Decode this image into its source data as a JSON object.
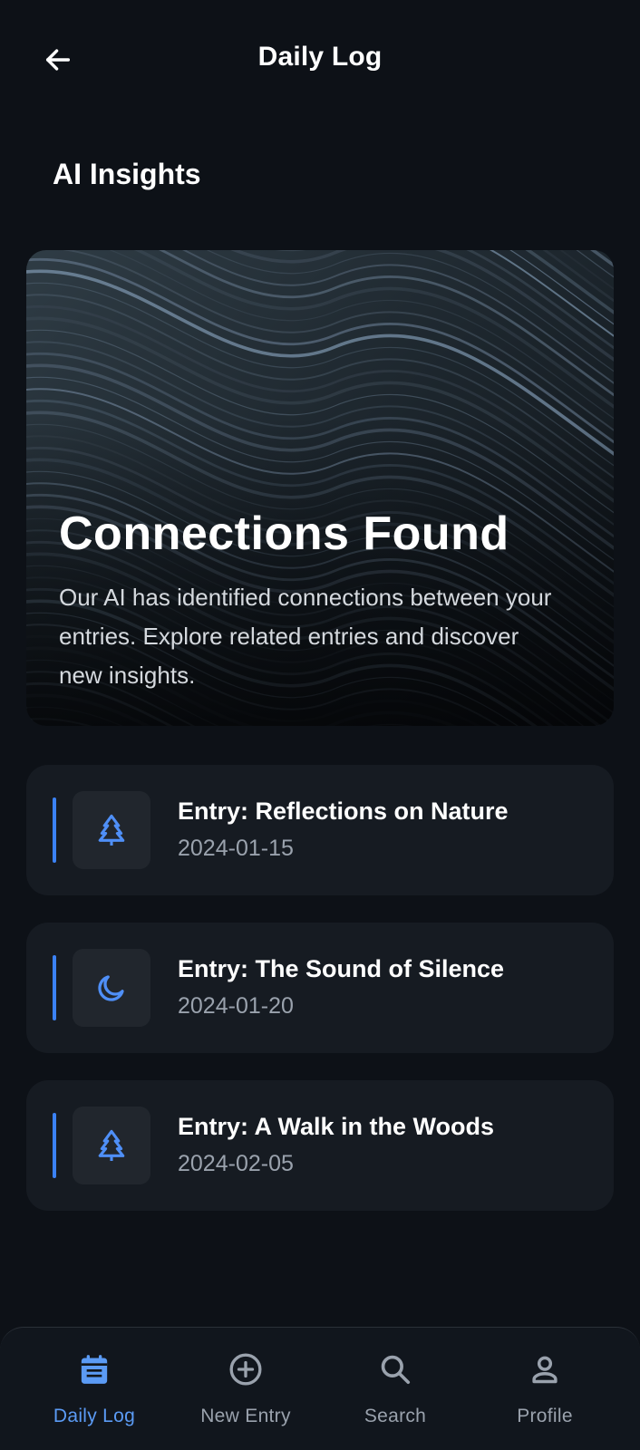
{
  "header": {
    "title": "Daily Log",
    "back_icon": "arrow-left-icon"
  },
  "section": {
    "title": "AI Insights"
  },
  "hero": {
    "title": "Connections Found",
    "description": "Our AI has identified connections between your entries. Explore related entries and discover new insights."
  },
  "entries": [
    {
      "title": "Entry: Reflections on Nature",
      "date": "2024-01-15",
      "icon": "tree-icon"
    },
    {
      "title": "Entry: The Sound of Silence",
      "date": "2024-01-20",
      "icon": "moon-icon"
    },
    {
      "title": "Entry: A Walk in the Woods",
      "date": "2024-02-05",
      "icon": "tree-icon"
    }
  ],
  "nav": [
    {
      "label": "Daily Log",
      "icon": "calendar-icon",
      "active": true
    },
    {
      "label": "New Entry",
      "icon": "plus-circle-icon",
      "active": false
    },
    {
      "label": "Search",
      "icon": "search-icon",
      "active": false
    },
    {
      "label": "Profile",
      "icon": "user-icon",
      "active": false
    }
  ],
  "colors": {
    "background": "#0d1117",
    "card": "#161b22",
    "accent": "#3b82f6",
    "nav_active": "#5b9bf5",
    "muted_text": "#9aa2ad"
  }
}
